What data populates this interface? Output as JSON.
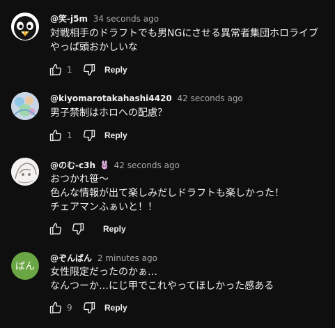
{
  "comments": [
    {
      "author": "@笑-j5m",
      "time": "34 seconds ago",
      "text": "対戦相手のドラフトでも男NGにさせる異常者集団ホロライブ\nやっぱ頭おかしいな",
      "likes": "1",
      "reply_label": "Reply",
      "avatar_icon": "penguin-avatar"
    },
    {
      "author": "@kiyomarotakahashi4420",
      "time": "42 seconds ago",
      "text": "男子禁制はホロへの配慮？",
      "likes": "1",
      "reply_label": "Reply",
      "avatar_icon": "pastel-art-avatar"
    },
    {
      "author": "@のむ-c3h",
      "badge_icon": "bunny-emoji-icon",
      "time": "42 seconds ago",
      "text": "おつかれ笹～\n色んな情報が出て楽しみだしドラフトも楽しかった！\nチェアマンふぁいと！！",
      "likes": "",
      "reply_label": "Reply",
      "avatar_icon": "anime-sketch-avatar"
    },
    {
      "author": "@ぞんばん",
      "time": "2 minutes ago",
      "text": "女性限定だったのかぁ…\nなんつーか…にじ甲でこれやってほしかった感ある",
      "likes": "9",
      "reply_label": "Reply",
      "avatar_text": "ばん",
      "avatar_color": "#6ba644"
    }
  ]
}
